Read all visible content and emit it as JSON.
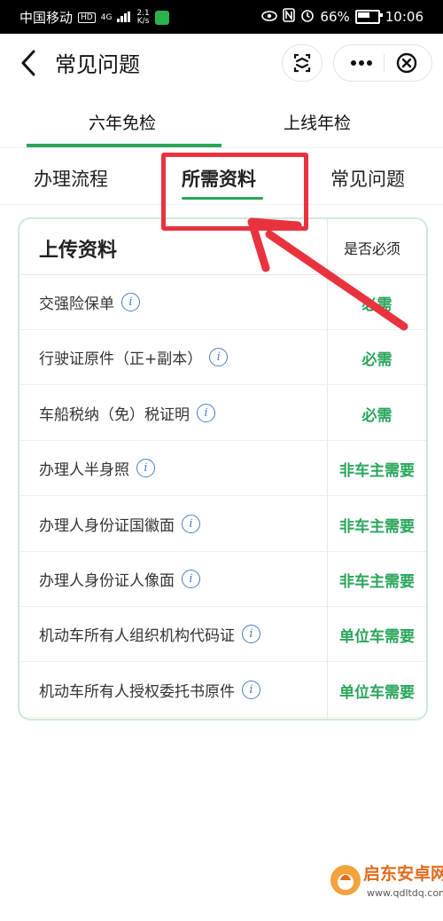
{
  "status_bar": {
    "carrier": "中国移动",
    "hd_badge": "HD",
    "signal": "4G",
    "speed_value": "2.1",
    "speed_unit": "K/s",
    "battery": "66%",
    "time": "10:06"
  },
  "nav": {
    "title": "常见问题"
  },
  "main_tabs": [
    {
      "label": "六年免检",
      "active": true
    },
    {
      "label": "上线年检",
      "active": false
    }
  ],
  "sub_tabs": [
    {
      "label": "办理流程",
      "active": false
    },
    {
      "label": "所需资料",
      "active": true
    },
    {
      "label": "常见问题",
      "active": false
    }
  ],
  "table": {
    "header_left": "上传资料",
    "header_right": "是否必须",
    "info_icon_glyph": "i",
    "rows": [
      {
        "name": "交强险保单",
        "requirement": "必需"
      },
      {
        "name": "行驶证原件（正+副本）",
        "requirement": "必需"
      },
      {
        "name": "车船税纳（免）税证明",
        "requirement": "必需"
      },
      {
        "name": "办理人半身照",
        "requirement": "非车主需要"
      },
      {
        "name": "办理人身份证国徽面",
        "requirement": "非车主需要"
      },
      {
        "name": "办理人身份证人像面",
        "requirement": "非车主需要"
      },
      {
        "name": "机动车所有人组织机构代码证",
        "requirement": "单位车需要"
      },
      {
        "name": "机动车所有人授权委托书原件",
        "requirement": "单位车需要"
      }
    ]
  },
  "watermark": {
    "brand": "启东安卓网",
    "url": "www.qdltdq.com"
  },
  "colors": {
    "accent_green": "#2aa55b",
    "annotation_red": "#e8333f",
    "info_blue": "#4a7ccf"
  }
}
